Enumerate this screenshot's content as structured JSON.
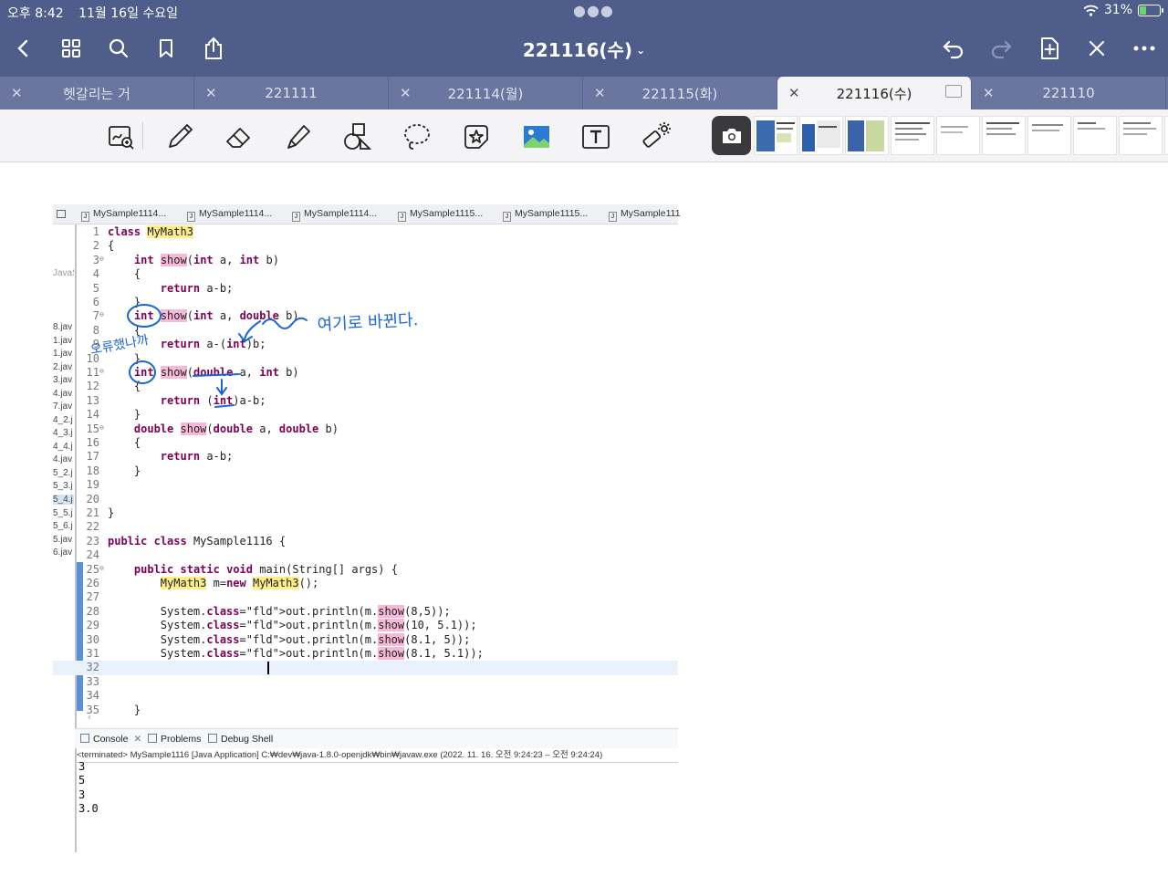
{
  "status": {
    "time": "오후 8:42",
    "date": "11월 16일 수요일",
    "battery": "31%",
    "battery_level": 0.31
  },
  "header": {
    "title": "221116(수)"
  },
  "tabs": [
    {
      "label": "헷갈리는 거",
      "active": false
    },
    {
      "label": "221111",
      "active": false
    },
    {
      "label": "221114(월)",
      "active": false
    },
    {
      "label": "221115(화)",
      "active": false
    },
    {
      "label": "221116(수)",
      "active": true
    },
    {
      "label": "221110",
      "active": false
    }
  ],
  "icons": {
    "topbar": [
      "back-icon",
      "grid-icon",
      "search-icon",
      "bookmark-icon",
      "share-icon",
      "undo-icon",
      "redo-icon",
      "add-page-icon",
      "close-bluetooth-icon",
      "more-icon"
    ],
    "toolbar": [
      "zoom-pen-icon",
      "pen-icon",
      "eraser-icon",
      "highlighter-icon",
      "shapes-icon",
      "lasso-icon",
      "sticker-icon",
      "image-icon",
      "text-icon",
      "laser-icon",
      "camera-icon"
    ]
  },
  "eclipse": {
    "file_tabs": [
      "MySample1114...",
      "MySample1114...",
      "MySample1114...",
      "MySample1115...",
      "MySample1115...",
      "MySample111"
    ],
    "package_items": [
      "JavaS",
      "8.jav",
      "1.jav",
      "1.jav",
      "2.jav",
      "3.jav",
      "4.jav",
      "7.jav",
      "4_2.j",
      "4_3.j",
      "4_4.j",
      "4.jav",
      "5_2.j",
      "5_3.j",
      "5_4.j",
      "5_5.j",
      "5_6.j",
      "5.jav",
      "6.jav"
    ],
    "lines": [
      {
        "n": "1",
        "code": "class MyMath3"
      },
      {
        "n": "2",
        "code": "{"
      },
      {
        "n": "3",
        "code": "    int show(int a, int b)"
      },
      {
        "n": "4",
        "code": "    {"
      },
      {
        "n": "5",
        "code": "        return a-b;"
      },
      {
        "n": "6",
        "code": "    }"
      },
      {
        "n": "7",
        "code": "    int show(int a, double b)"
      },
      {
        "n": "8",
        "code": "    {"
      },
      {
        "n": "9",
        "code": "        return a-(int)b;"
      },
      {
        "n": "10",
        "code": "    }"
      },
      {
        "n": "11",
        "code": "    int show(double a, int b)"
      },
      {
        "n": "12",
        "code": "    {"
      },
      {
        "n": "13",
        "code": "        return (int)a-b;"
      },
      {
        "n": "14",
        "code": "    }"
      },
      {
        "n": "15",
        "code": "    double show(double a, double b)"
      },
      {
        "n": "16",
        "code": "    {"
      },
      {
        "n": "17",
        "code": "        return a-b;"
      },
      {
        "n": "18",
        "code": "    }"
      },
      {
        "n": "19",
        "code": ""
      },
      {
        "n": "20",
        "code": ""
      },
      {
        "n": "21",
        "code": "}"
      },
      {
        "n": "22",
        "code": ""
      },
      {
        "n": "23",
        "code": "public class MySample1116 {"
      },
      {
        "n": "24",
        "code": ""
      },
      {
        "n": "25",
        "code": "    public static void main(String[] args) {"
      },
      {
        "n": "26",
        "code": "        MyMath3 m=new MyMath3();"
      },
      {
        "n": "27",
        "code": ""
      },
      {
        "n": "28",
        "code": "        System.out.println(m.show(8,5));"
      },
      {
        "n": "29",
        "code": "        System.out.println(m.show(10, 5.1));"
      },
      {
        "n": "30",
        "code": "        System.out.println(m.show(8.1, 5));"
      },
      {
        "n": "31",
        "code": "        System.out.println(m.show(8.1, 5.1));"
      },
      {
        "n": "32",
        "code": ""
      },
      {
        "n": "33",
        "code": ""
      },
      {
        "n": "34",
        "code": ""
      },
      {
        "n": "35",
        "code": "    }"
      }
    ],
    "console_tabs": {
      "console": "Console",
      "problems": "Problems",
      "debug": "Debug Shell"
    },
    "terminated": "<terminated> MySample1116 [Java Application] C:₩dev₩java-1.8.0-openjdk₩bin₩javaw.exe  (2022. 11. 16. 오전 9:24:23 – 오전 9:24:24)",
    "output": [
      "3",
      "5",
      "3",
      "3.0"
    ]
  },
  "annotations": {
    "note1": "여기로 바뀐다.",
    "note2": "오류했나까"
  },
  "colors": {
    "header_bg": "#4f5d8a",
    "tab_bg": "#6a76a0",
    "ink": "#1a66d6",
    "highlight_yellow": "#ffef8a",
    "highlight_pink": "#f8b8d8"
  }
}
